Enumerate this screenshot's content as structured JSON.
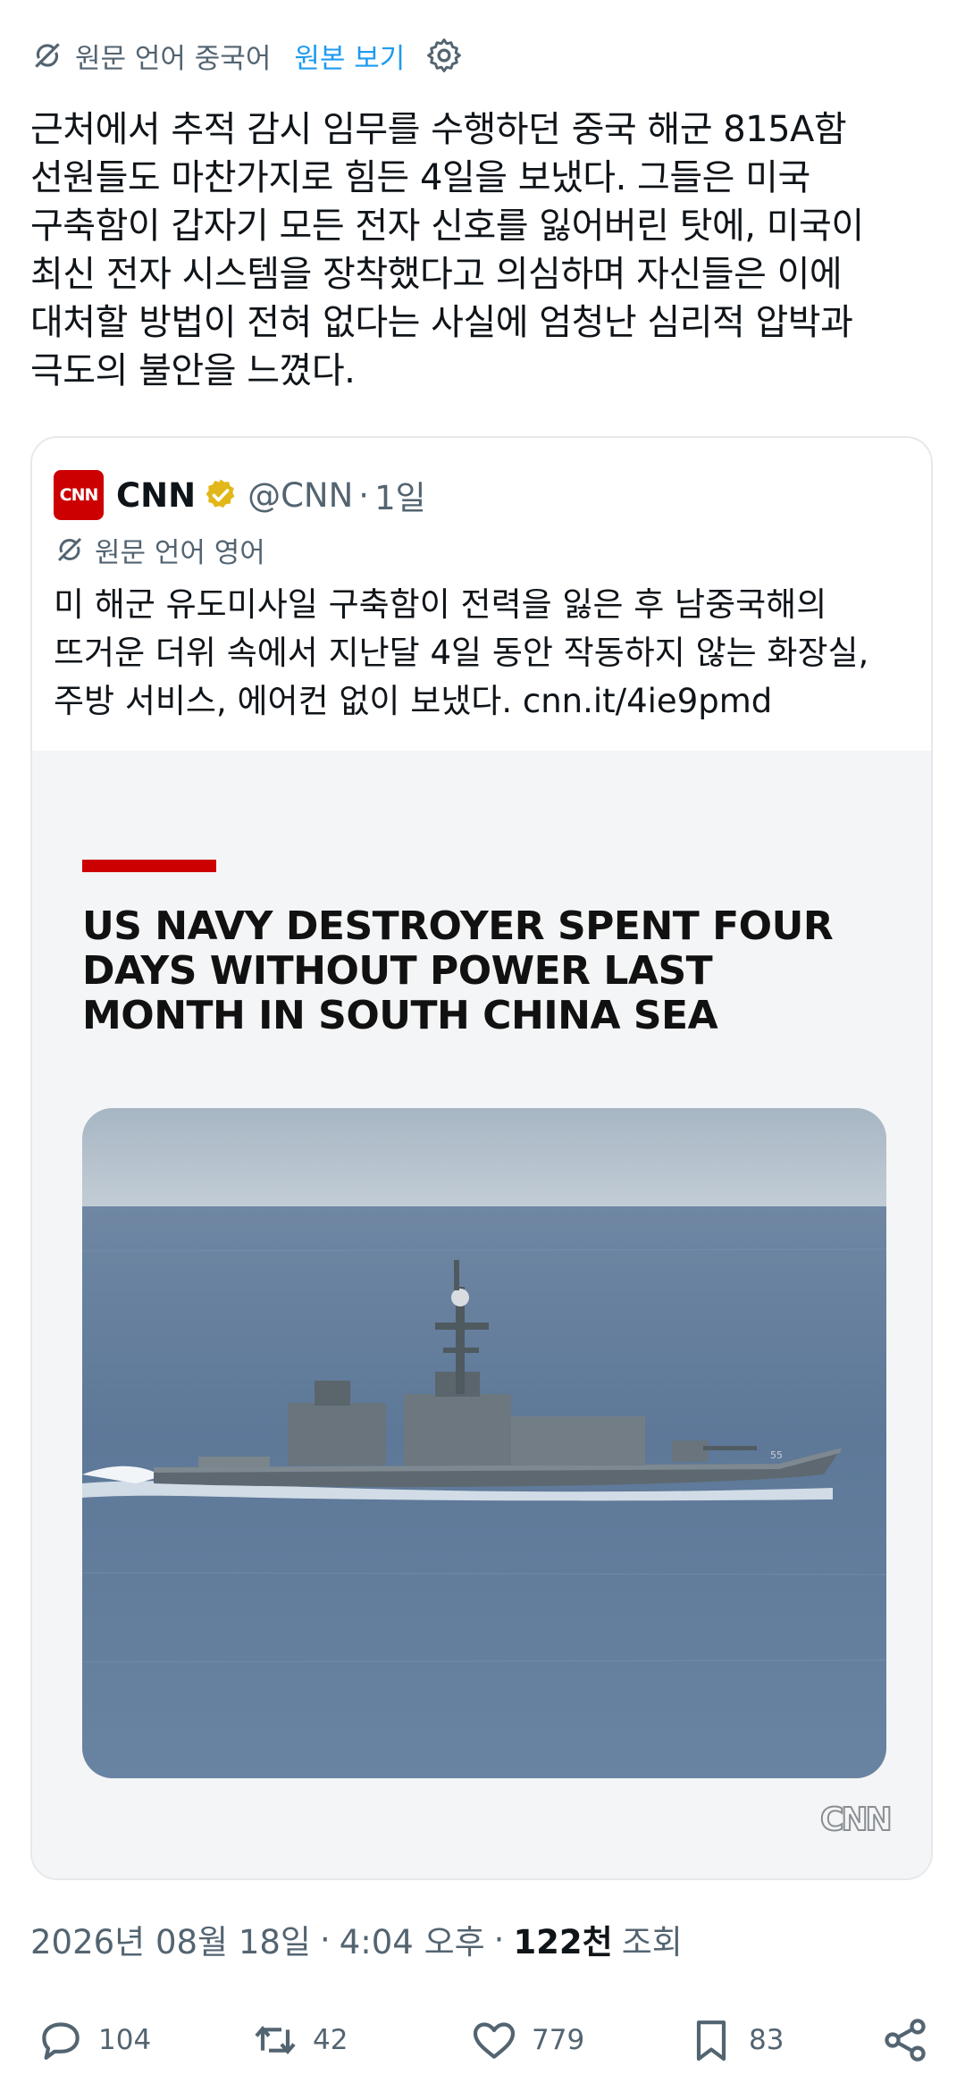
{
  "translation_bar": {
    "source_language": "원문 언어 중국어",
    "view_original": "원본 보기",
    "icons": [
      "translate-icon",
      "gear-icon"
    ]
  },
  "tweet": {
    "text": "근처에서 추적 감시 임무를 수행하던 중국 해군 815A함\n선원들도 마찬가지로 힘든 4일을 보냈다. 그들은 미국\n구축함이 갑자기 모든 전자 신호를 잃어버린 탓에, 미국이\n최신 전자 시스템을 장착했다고 의심하며 자신들은 이에\n대처할 방법이 전혀 없다는 사실에 엄청난 심리적 압박과\n극도의 불안을 느꼈다."
  },
  "quote": {
    "avatar_text": "CNN",
    "name": "CNN",
    "handle": "@CNN",
    "separator": "·",
    "time": "1일",
    "source_language": "원문 언어 영어",
    "text": "미 해군 유도미사일 구축함이 전력을 잃은 후 남중국해의\n뜨거운 더위 속에서 지난달 4일 동안 작동하지 않는 화장실,\n주방 서비스, 에어컨 없이 보냈다. ",
    "link": "cnn.it/4ie9pmd",
    "media": {
      "headline": "US NAVY DESTROYER SPENT FOUR\nDAYS WITHOUT POWER LAST\nMONTH IN SOUTH CHINA SEA",
      "watermark": "CNN",
      "accent_color": "#cc0000"
    }
  },
  "meta": {
    "date": "2026년 08월 18일",
    "dot": "·",
    "time": "4:04 오후",
    "dot2": "·",
    "views_count": "122천",
    "views_label": "조회"
  },
  "actions": {
    "reply_count": "104",
    "retweet_count": "42",
    "like_count": "779",
    "bookmark_count": "83"
  },
  "colors": {
    "text": "#0f1419",
    "secondary": "#536471",
    "link": "#1d9bf0",
    "verified": "#e2b719"
  }
}
